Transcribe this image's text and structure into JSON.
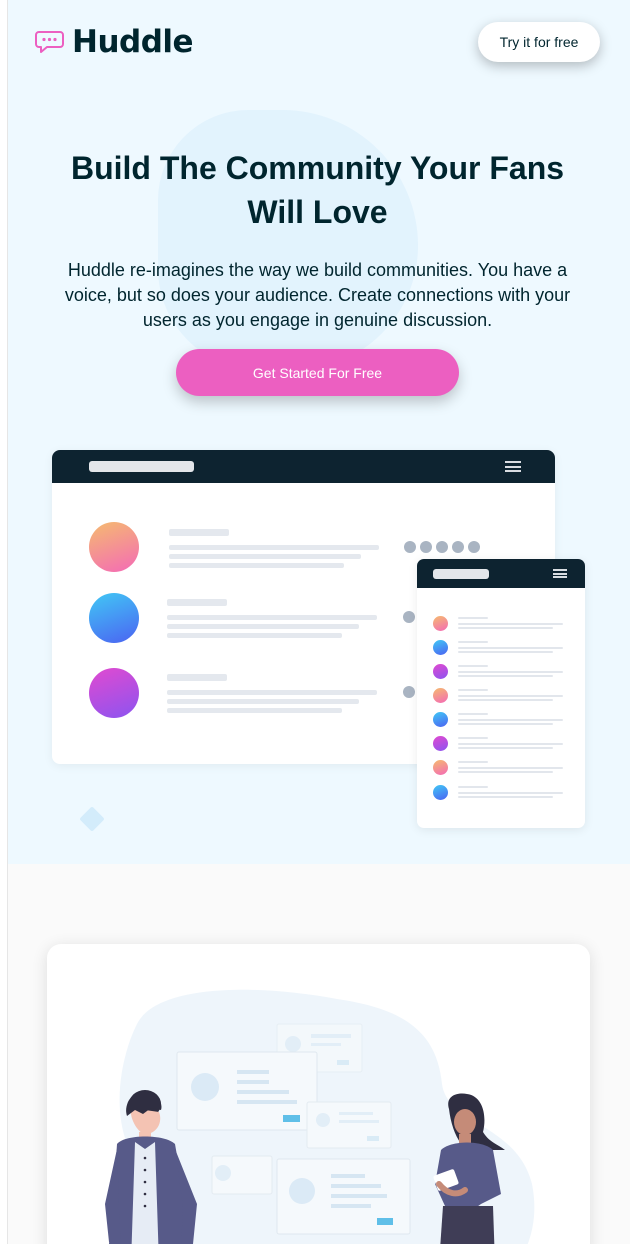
{
  "brand": {
    "name": "Huddle",
    "accent": "#ec5fc1",
    "dark": "#00252e",
    "hero_bg": "#eef9ff"
  },
  "header": {
    "cta_label": "Try it for free"
  },
  "hero": {
    "title": "Build The Community Your Fans Will Love",
    "subtitle": "Huddle re-imagines the way we build communities. You have a voice, but so does your audience. Create connections with your users as you engage in genuine discussion.",
    "cta_label": "Get Started For Free"
  },
  "icons": {
    "logo": "chat-bubble-icon",
    "menu": "hamburger-menu-icon"
  },
  "illustration": {
    "name": "people-chatting-illustration"
  }
}
